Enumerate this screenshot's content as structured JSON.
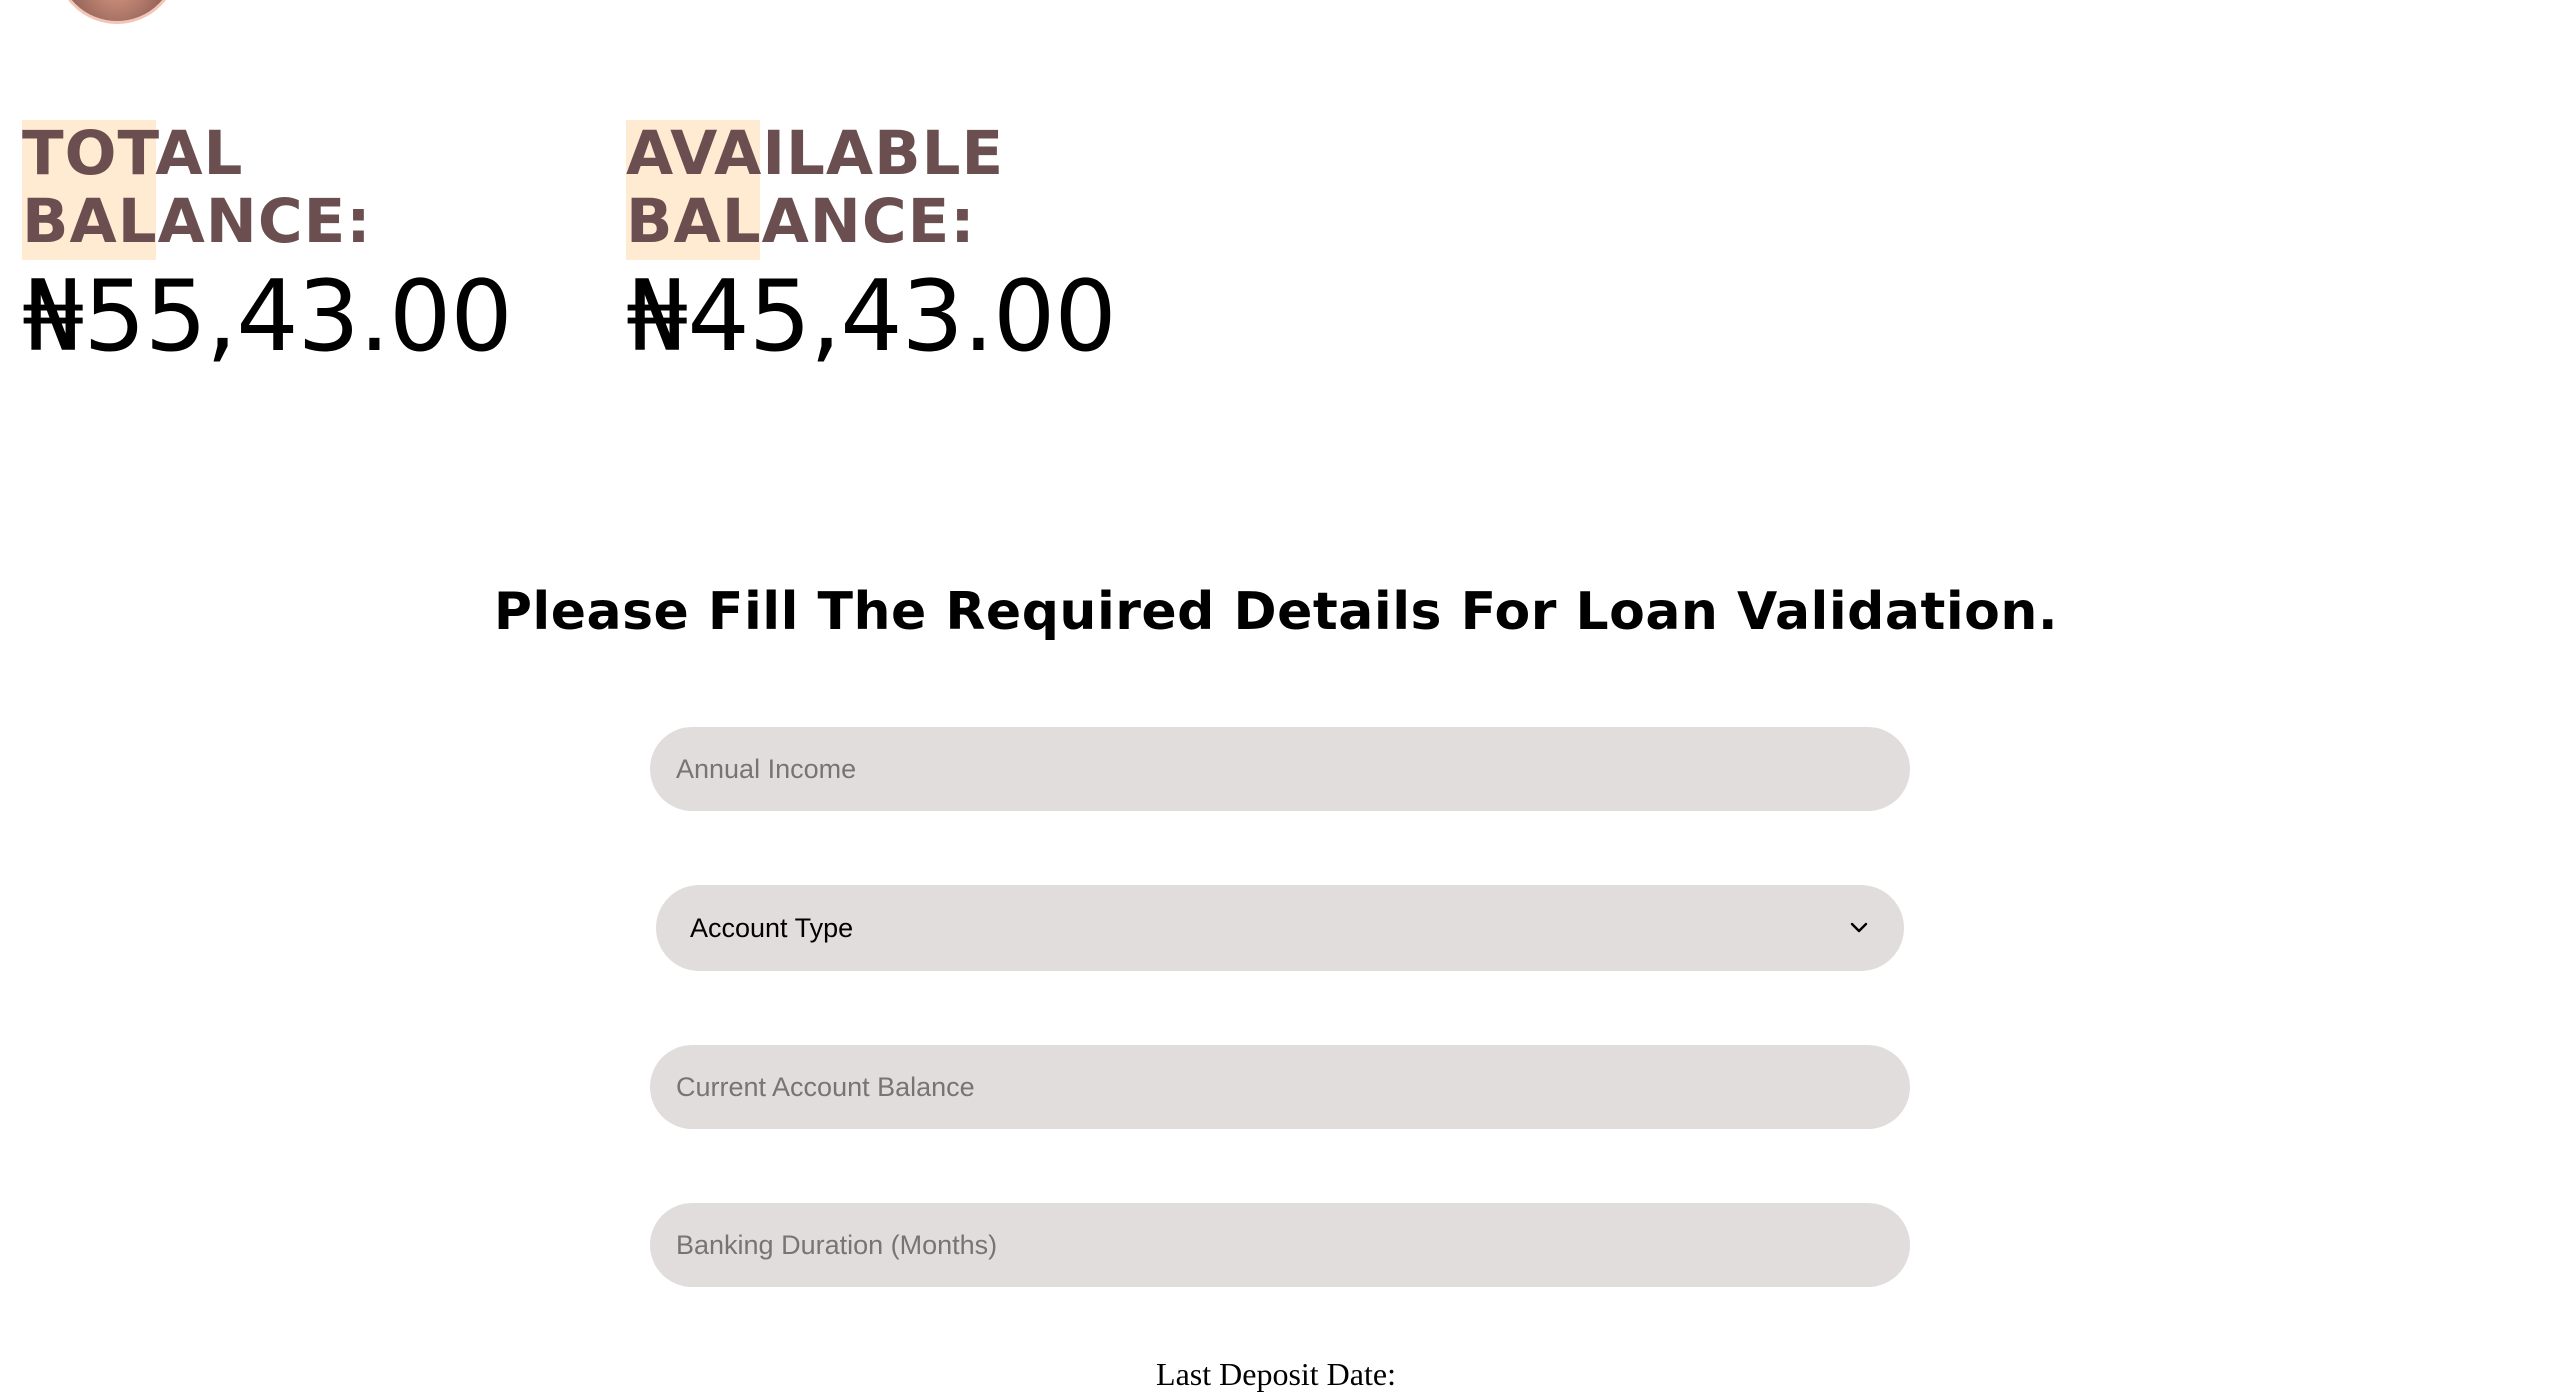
{
  "profile": {
    "avatar_icon": "user-avatar-icon"
  },
  "balances": {
    "total": {
      "label": "TOTAL BALANCE:",
      "amount": "₦55,43.00"
    },
    "available": {
      "label": "AVAILABLE BALANCE:",
      "amount": "₦45,43.00"
    }
  },
  "loan_form": {
    "title": "Please Fill The Required Details For Loan Validation.",
    "annual_income": {
      "placeholder": "Annual Income",
      "value": ""
    },
    "account_type": {
      "selected": "Account Type",
      "icon": "chevron-down-icon"
    },
    "current_balance": {
      "placeholder": "Current Account Balance",
      "value": ""
    },
    "banking_duration": {
      "placeholder": "Banking Duration (Months)",
      "value": ""
    },
    "last_deposit_label": "Last Deposit Date:"
  },
  "colors": {
    "label_text": "#6b4f50",
    "label_highlight": "#ffead2",
    "field_background": "#e2dddd",
    "placeholder_text": "#7a7373"
  }
}
